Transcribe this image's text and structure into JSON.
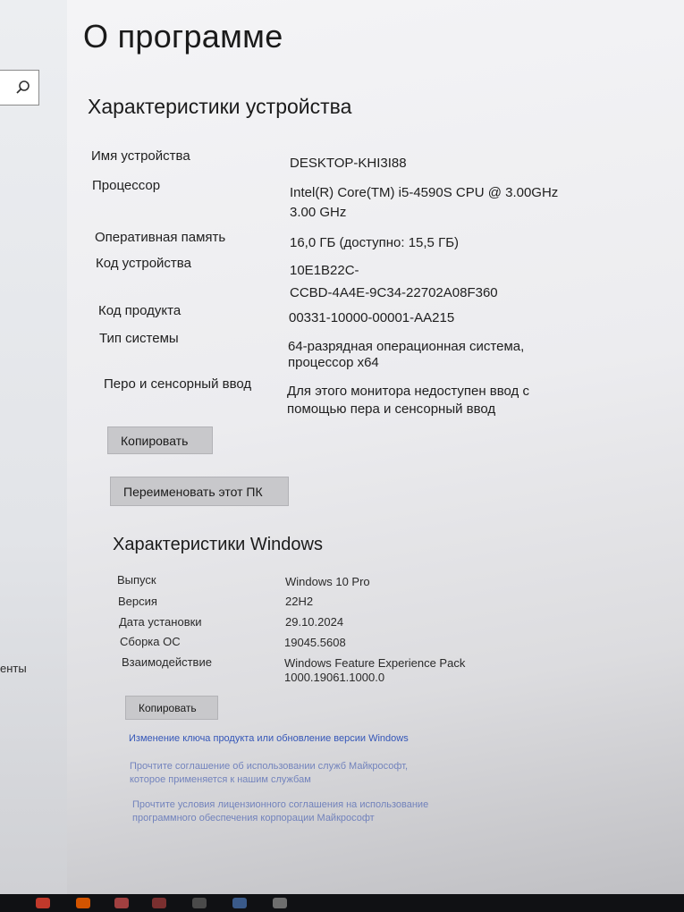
{
  "window": {
    "title": "О программе"
  },
  "sidebar": {
    "partial_item": "енты"
  },
  "device_specs": {
    "heading": "Характеристики устройства",
    "rows": [
      {
        "label": "Имя устройства",
        "value_lines": [
          "DESKTOP-KHI3I88"
        ]
      },
      {
        "label": "Процессор",
        "value_lines": [
          "Intel(R) Core(TM) i5-4590S CPU @ 3.00GHz",
          "3.00 GHz"
        ]
      },
      {
        "label": "Оперативная память",
        "value_lines": [
          "16,0 ГБ (доступно: 15,5 ГБ)"
        ]
      },
      {
        "label": "Код устройства",
        "value_lines": [
          "10E1B22C-",
          "CCBD-4A4E-9C34-22702A08F360"
        ]
      },
      {
        "label": "Код продукта",
        "value_lines": [
          "00331-10000-00001-AA215"
        ]
      },
      {
        "label": "Тип системы",
        "value_lines": [
          "64-разрядная операционная система,",
          "процессор x64"
        ]
      },
      {
        "label": "Перо и сенсорный ввод",
        "value_lines": [
          "Для этого монитора недоступен ввод с",
          "помощью пера и сенсорный ввод"
        ]
      }
    ],
    "copy_button": "Копировать",
    "rename_button": "Переименовать этот ПК"
  },
  "windows_specs": {
    "heading": "Характеристики Windows",
    "rows": [
      {
        "label": "Выпуск",
        "value_lines": [
          "Windows 10 Pro"
        ]
      },
      {
        "label": "Версия",
        "value_lines": [
          "22H2"
        ]
      },
      {
        "label": "Дата установки",
        "value_lines": [
          "29.10.2024"
        ]
      },
      {
        "label": "Сборка ОС",
        "value_lines": [
          "19045.5608"
        ]
      },
      {
        "label": "Взаимодействие",
        "value_lines": [
          "Windows Feature Experience Pack",
          "1000.19061.1000.0"
        ]
      }
    ],
    "copy_button": "Копировать"
  },
  "links": [
    {
      "lines": [
        "Изменение ключа продукта или обновление версии Windows"
      ]
    },
    {
      "lines": [
        "Прочтите соглашение об использовании служб Майкрософт,",
        "которое применяется к нашим службам"
      ]
    },
    {
      "lines": [
        "Прочтите условия лицензионного соглашения на использование",
        "программного обеспечения корпорации Майкрософт"
      ]
    }
  ],
  "icons": {
    "search": "search-icon"
  }
}
